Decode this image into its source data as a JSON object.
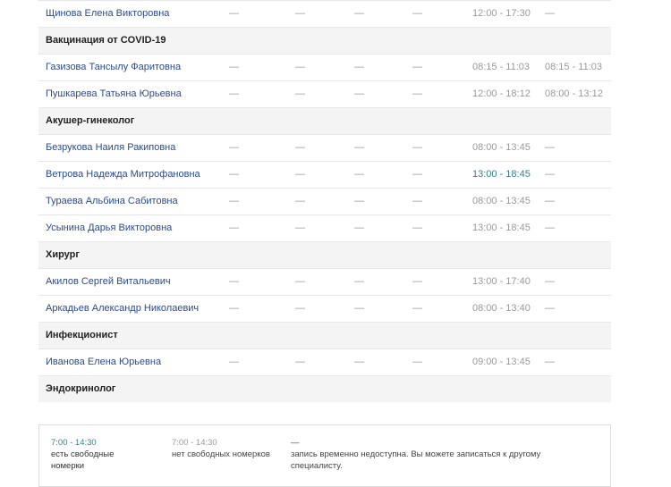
{
  "dash": "—",
  "schedule": {
    "rows": [
      {
        "type": "doctor",
        "name": "Щинова Елена Викторовна",
        "slots": [
          "—",
          "—",
          "—",
          "—",
          "12:00 - 17:30",
          "—"
        ],
        "status": [
          "d",
          "d",
          "d",
          "d",
          "t",
          "d"
        ]
      },
      {
        "type": "section",
        "title": "Вакцинация от COVID-19"
      },
      {
        "type": "doctor",
        "name": "Газизова Тансылу Фаритовна",
        "slots": [
          "—",
          "—",
          "—",
          "—",
          "08:15 - 11:03",
          "08:15 - 11:03"
        ],
        "status": [
          "d",
          "d",
          "d",
          "d",
          "t",
          "t"
        ]
      },
      {
        "type": "doctor",
        "name": "Пушкарева Татьяна Юрьевна",
        "slots": [
          "—",
          "—",
          "—",
          "—",
          "12:00 - 18:12",
          "08:00 - 13:12"
        ],
        "status": [
          "d",
          "d",
          "d",
          "d",
          "t",
          "t"
        ]
      },
      {
        "type": "section",
        "title": "Акушер-гинеколог"
      },
      {
        "type": "doctor",
        "name": "Безрукова Наиля Ракиповна",
        "slots": [
          "—",
          "—",
          "—",
          "—",
          "08:00 - 13:45",
          "—"
        ],
        "status": [
          "d",
          "d",
          "d",
          "d",
          "t",
          "d"
        ]
      },
      {
        "type": "doctor",
        "name": "Ветрова Надежда Митрофановна",
        "slots": [
          "—",
          "—",
          "—",
          "—",
          "13:00 - 18:45",
          "—"
        ],
        "status": [
          "d",
          "d",
          "d",
          "d",
          "a",
          "d"
        ]
      },
      {
        "type": "doctor",
        "name": "Тураева Альбина Сабитовна",
        "slots": [
          "—",
          "—",
          "—",
          "—",
          "08:00 - 13:45",
          "—"
        ],
        "status": [
          "d",
          "d",
          "d",
          "d",
          "t",
          "d"
        ]
      },
      {
        "type": "doctor",
        "name": "Усынина Дарья Викторовна",
        "slots": [
          "—",
          "—",
          "—",
          "—",
          "13:00 - 18:45",
          "—"
        ],
        "status": [
          "d",
          "d",
          "d",
          "d",
          "t",
          "d"
        ]
      },
      {
        "type": "section",
        "title": "Хирург"
      },
      {
        "type": "doctor",
        "name": "Акилов Сергей Витальевич",
        "slots": [
          "—",
          "—",
          "—",
          "—",
          "13:00 - 17:40",
          "—"
        ],
        "status": [
          "d",
          "d",
          "d",
          "d",
          "t",
          "d"
        ]
      },
      {
        "type": "doctor",
        "name": "Аркадьев Александр Николаевич",
        "slots": [
          "—",
          "—",
          "—",
          "—",
          "08:00 - 13:40",
          "—"
        ],
        "status": [
          "d",
          "d",
          "d",
          "d",
          "t",
          "d"
        ]
      },
      {
        "type": "section",
        "title": "Инфекционист"
      },
      {
        "type": "doctor",
        "name": "Иванова Елена Юрьевна",
        "slots": [
          "—",
          "—",
          "—",
          "—",
          "09:00 - 13:45",
          "—"
        ],
        "status": [
          "d",
          "d",
          "d",
          "d",
          "t",
          "d"
        ]
      },
      {
        "type": "section",
        "title": "Эндокринолог"
      }
    ]
  },
  "legend": {
    "available_time": "7:00 - 14:30",
    "available_text": "есть свободные номерки",
    "full_time": "7:00 - 14:30",
    "full_text": "нет свободных номерков",
    "dash": "—",
    "unavailable_text": "запись временно недоступна. Вы можете записаться к другому специалисту."
  }
}
